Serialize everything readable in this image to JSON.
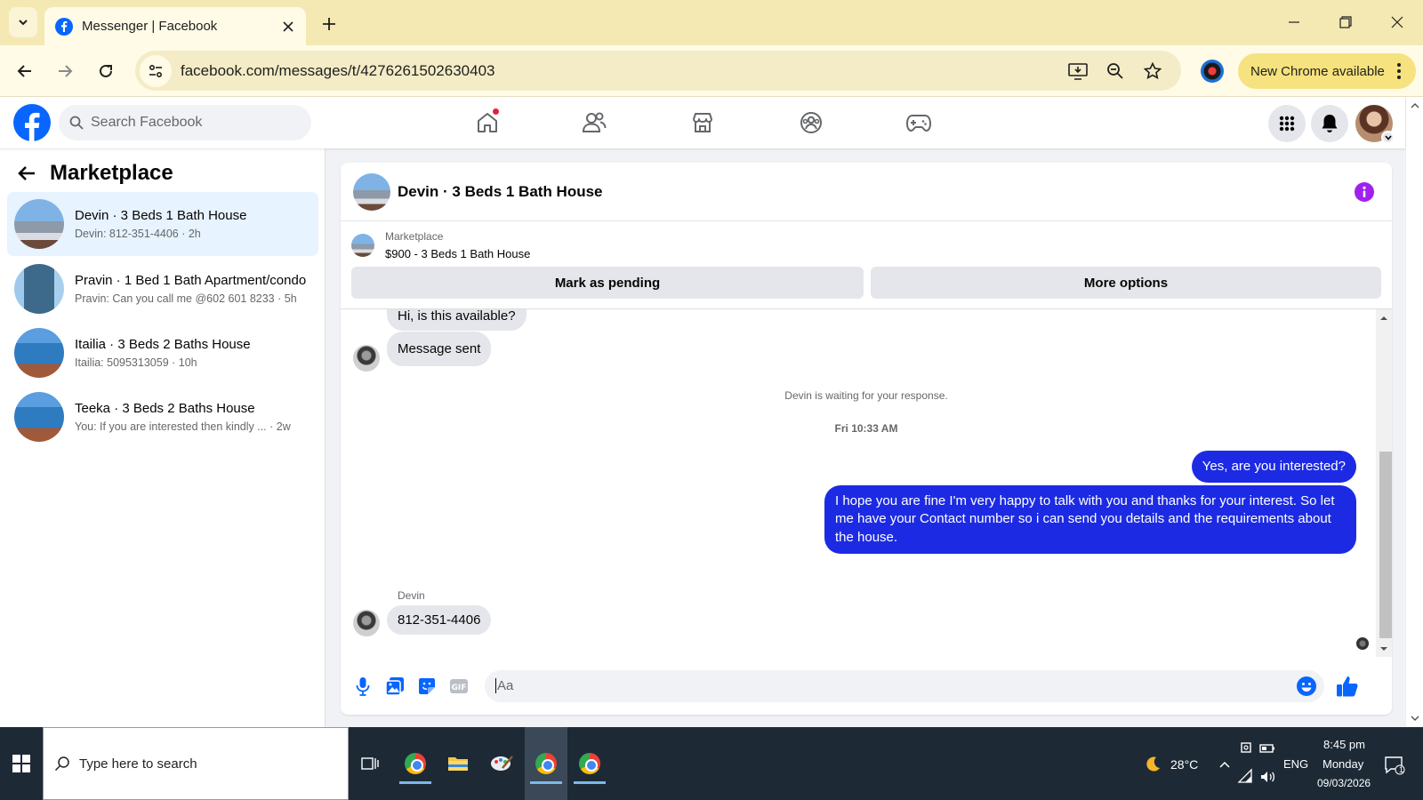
{
  "browser": {
    "tab_title": "Messenger | Facebook",
    "url": "facebook.com/messages/t/4276261502630403",
    "update_label": "New Chrome available"
  },
  "fb": {
    "search_placeholder": "Search Facebook",
    "nav_icons": [
      "home-icon",
      "friends-icon",
      "marketplace-icon",
      "groups-icon",
      "gaming-icon"
    ],
    "brand_color": "#0866ff"
  },
  "sidebar": {
    "title": "Marketplace",
    "conversations": [
      {
        "name": "Devin · 3 Beds 1 Bath House",
        "preview": "Devin: 812-351-4406 · 2h"
      },
      {
        "name": "Pravin · 1 Bed 1 Bath Apartment/condo",
        "preview": "Pravin: Can you call me @602 601 8233 · 5h"
      },
      {
        "name": "Itailia · 3 Beds 2 Baths House",
        "preview": "Itailia: 5095313059 · 10h"
      },
      {
        "name": "Teeka · 3 Beds 2 Baths House",
        "preview": "You: If you are interested then kindly ... · 2w"
      }
    ]
  },
  "chat": {
    "title": "Devin · 3 Beds 1 Bath House",
    "listing_kicker": "Marketplace",
    "listing_title": "$900 - 3 Beds 1 Bath House",
    "mark_pending": "Mark as pending",
    "more_options": "More options",
    "msg_available": "Hi, is this available?",
    "msg_sent": "Message sent",
    "waiting": "Devin is waiting for your response.",
    "timestamp": "Fri 10:33 AM",
    "reply1": "Yes, are you interested?",
    "reply2": "I hope you are fine I'm very happy to talk with you and thanks for your interest. So let me have your Contact number so i can send you details and the requirements about the house.",
    "sender": "Devin",
    "msg_number": "812-351-4406",
    "composer_placeholder": "Aa",
    "outgoing_color": "#1c2be3"
  },
  "taskbar": {
    "search_placeholder": "Type here to search",
    "temperature": "28°C",
    "language": "ENG",
    "time": "8:45 pm",
    "day": "Monday",
    "date": "09/03/2026",
    "notification_count": "1"
  }
}
